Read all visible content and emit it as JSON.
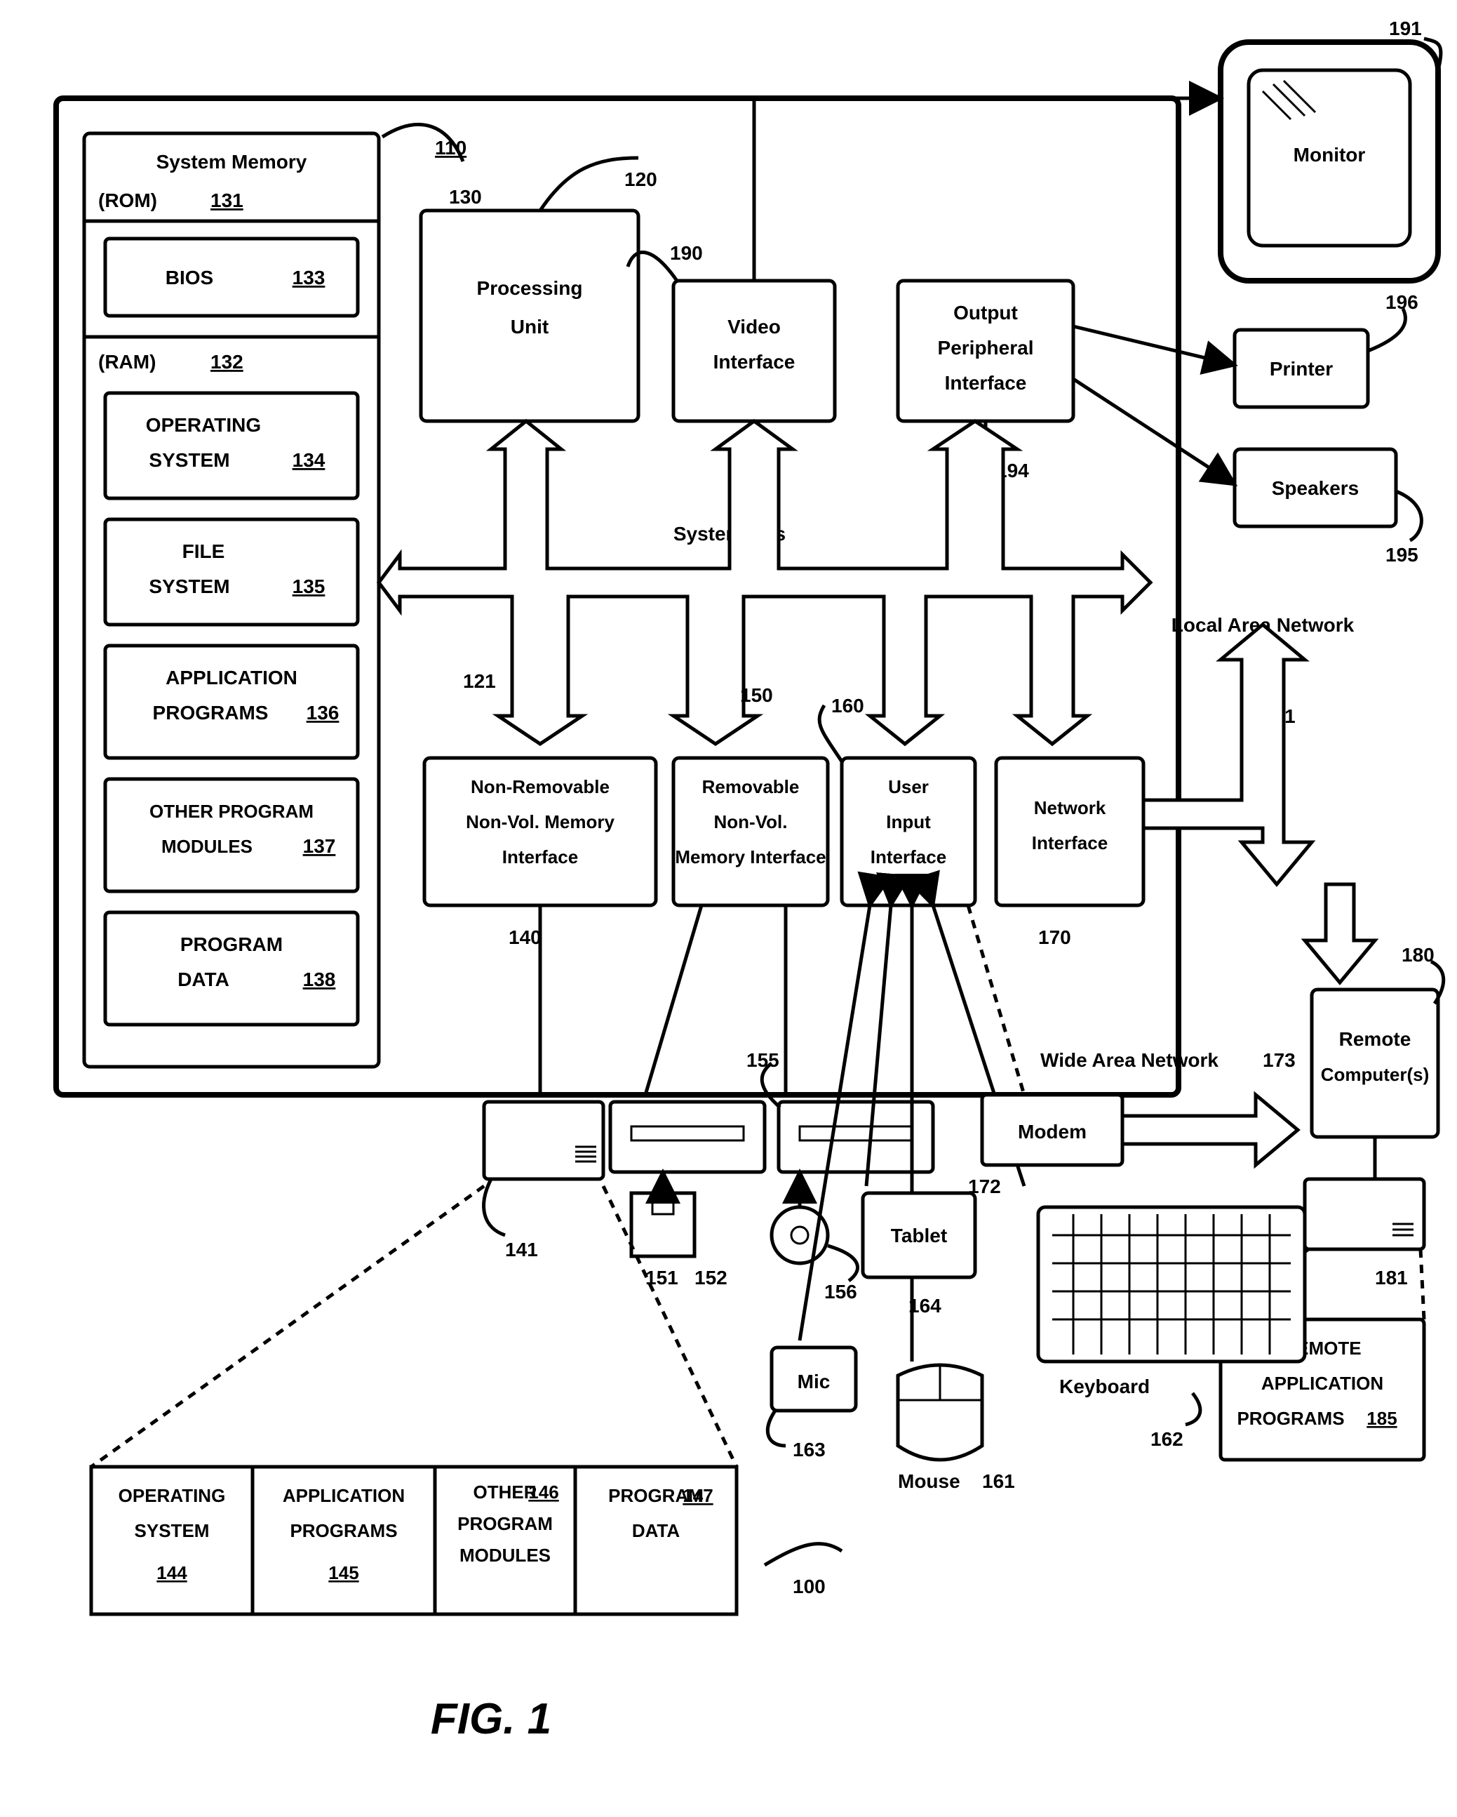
{
  "figure_label": "FIG. 1",
  "refs": {
    "system": "100",
    "computer": "110",
    "processing_unit": "120",
    "system_bus": "121",
    "system_memory": "130",
    "rom": "131",
    "ram": "132",
    "bios": "133",
    "operating_system_ram": "134",
    "file_system": "135",
    "application_programs_ram": "136",
    "other_program_modules_ram": "137",
    "program_data_ram": "138",
    "nonremovable_interface": "140",
    "hard_disk": "141",
    "operating_system_disk": "144",
    "application_programs_disk": "145",
    "other_program_modules_disk": "146",
    "program_data_disk": "147",
    "removable_interface": "150",
    "floppy_drive": "151",
    "floppy_disk": "152",
    "optical_drive": "155",
    "optical_disc": "156",
    "user_input_interface": "160",
    "mouse": "161",
    "keyboard": "162",
    "mic": "163",
    "tablet": "164",
    "network_interface": "170",
    "lan": "171",
    "modem": "172",
    "wan": "173",
    "remote_computer": "180",
    "remote_monitor": "181",
    "remote_application_programs": "185",
    "video_interface": "190",
    "monitor": "191",
    "output_peripheral_interface": "194",
    "speakers": "195",
    "printer": "196"
  },
  "labels": {
    "system_memory": "System Memory",
    "rom": "(ROM)",
    "ram": "(RAM)",
    "bios": "BIOS",
    "operating_system1": "OPERATING",
    "operating_system2": "SYSTEM",
    "file1": "FILE",
    "file2": "SYSTEM",
    "app1": "APPLICATION",
    "app2": "PROGRAMS",
    "other1": "OTHER PROGRAM",
    "other2": "MODULES",
    "program1": "PROGRAM",
    "program2": "DATA",
    "processing_unit1": "Processing",
    "processing_unit2": "Unit",
    "video1": "Video",
    "video2": "Interface",
    "output1": "Output",
    "output2": "Peripheral",
    "output3": "Interface",
    "system_bus": "System Bus",
    "nonremovable1": "Non-Removable",
    "nonremovable2": "Non-Vol. Memory",
    "nonremovable3": "Interface",
    "removable1": "Removable",
    "removable2": "Non-Vol.",
    "removable3": "Memory Interface",
    "user_input1": "User",
    "user_input2": "Input",
    "user_input3": "Interface",
    "network1": "Network",
    "network2": "Interface",
    "monitor": "Monitor",
    "printer": "Printer",
    "speakers": "Speakers",
    "lan": "Local Area Network",
    "wan": "Wide Area Network",
    "modem": "Modem",
    "remote1": "Remote",
    "remote2": "Computer(s)",
    "keyboard": "Keyboard",
    "tablet": "Tablet",
    "mic": "Mic",
    "mouse": "Mouse",
    "remote_app1": "REMOTE",
    "remote_app2": "APPLICATION",
    "remote_app3": "PROGRAMS",
    "disk_os1": "OPERATING",
    "disk_os2": "SYSTEM",
    "disk_app1": "APPLICATION",
    "disk_app2": "PROGRAMS",
    "disk_other1": "OTHER",
    "disk_other2": "PROGRAM",
    "disk_other3": "MODULES",
    "disk_data1": "PROGRAM",
    "disk_data2": "DATA"
  }
}
